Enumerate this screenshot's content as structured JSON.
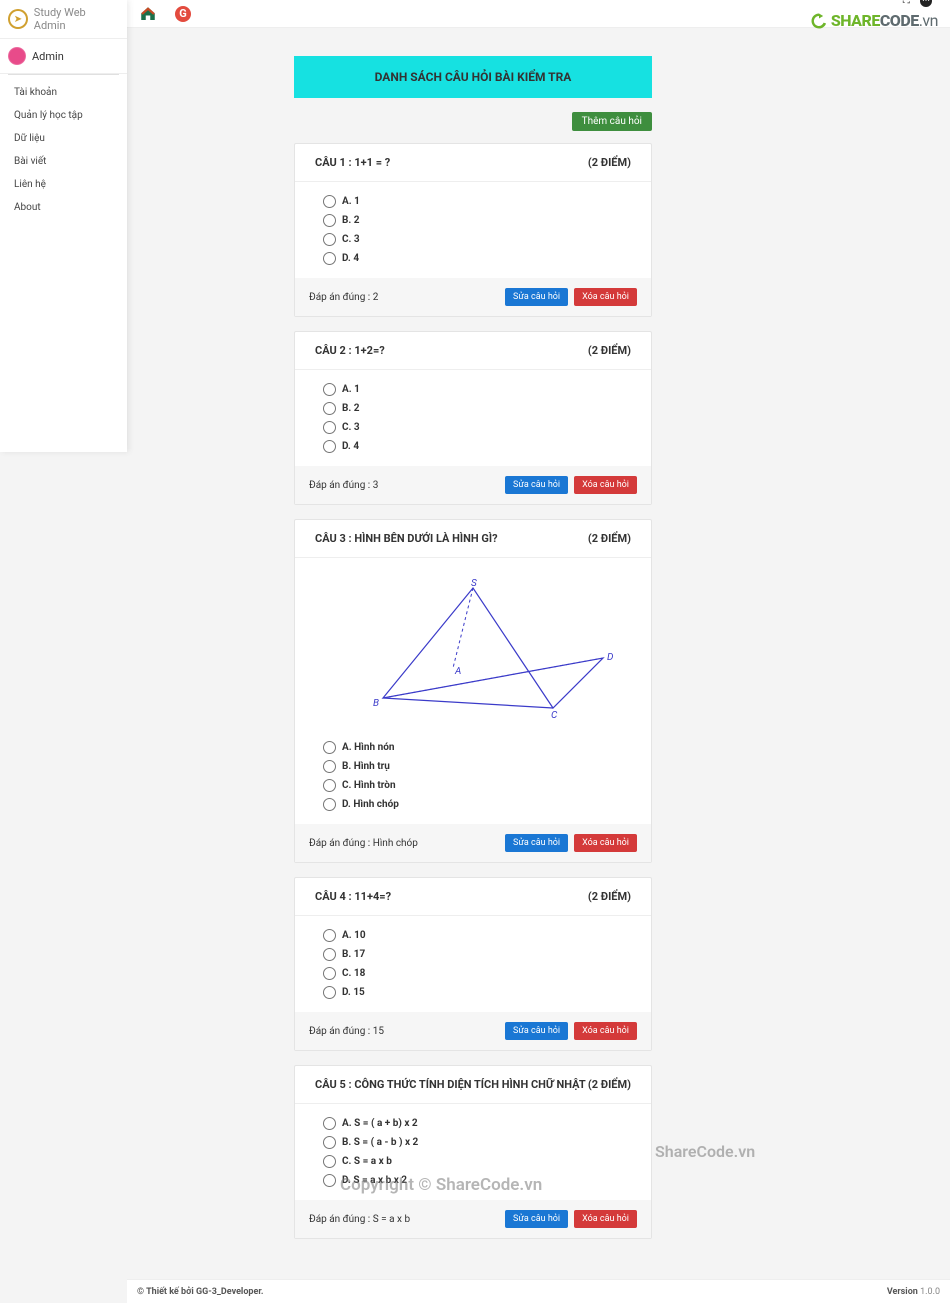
{
  "brand": {
    "name": "Study Web Admin"
  },
  "user": {
    "name": "Admin"
  },
  "nav": {
    "items": [
      {
        "label": "Tài khoản"
      },
      {
        "label": "Quản lý học tập"
      },
      {
        "label": "Dữ liệu"
      },
      {
        "label": "Bài viết"
      },
      {
        "label": "Liên hệ"
      },
      {
        "label": "About"
      }
    ]
  },
  "logo_text_1": "SHARE",
  "logo_text_2": "CODE",
  "logo_text_3": ".vn",
  "page": {
    "title": "DANH SÁCH CÂU HỎI BÀI KIỂM TRA",
    "add_btn": "Thêm câu hỏi"
  },
  "labels": {
    "edit": "Sửa câu hỏi",
    "delete": "Xóa câu hỏi"
  },
  "questions": [
    {
      "title": "CÂU 1 : 1+1 = ?",
      "points": "(2 ĐIỂM)",
      "options": [
        "A. 1",
        "B. 2",
        "C. 3",
        "D. 4"
      ],
      "answer": "Đáp án đúng : 2"
    },
    {
      "title": "CÂU 2 : 1+2=?",
      "points": "(2 ĐIỂM)",
      "options": [
        "A. 1",
        "B. 2",
        "C. 3",
        "D. 4"
      ],
      "answer": "Đáp án đúng : 3"
    },
    {
      "title": "CÂU 3 : HÌNH BÊN DƯỚI LÀ HÌNH GÌ?",
      "points": "(2 ĐIỂM)",
      "options": [
        "A. Hình nón",
        "B. Hình trụ",
        "C. Hình tròn",
        "D. Hình chóp"
      ],
      "answer": "Đáp án đúng : Hình chóp",
      "has_image": true
    },
    {
      "title": "CÂU 4 : 11+4=?",
      "points": "(2 ĐIỂM)",
      "options": [
        "A. 10",
        "B. 17",
        "C. 18",
        "D. 15"
      ],
      "answer": "Đáp án đúng : 15"
    },
    {
      "title": "CÂU 5 : CÔNG THỨC TÍNH DIỆN TÍCH HÌNH CHỮ NHẬT",
      "points": "(2 ĐIỂM)",
      "options": [
        "A. S = ( a + b) x 2",
        "B. S = ( a - b ) x 2",
        "C. S = a x b",
        "D. S = a x b x 2"
      ],
      "answer": "Đáp án đúng : S = a x b"
    }
  ],
  "footer": {
    "left": "© Thiết kế bởi GG-3_Developer.",
    "version_label": "Version",
    "version": "1.0.0"
  },
  "watermark": {
    "logo": "ShareCode.vn",
    "copy": "Copyright © ShareCode.vn"
  }
}
